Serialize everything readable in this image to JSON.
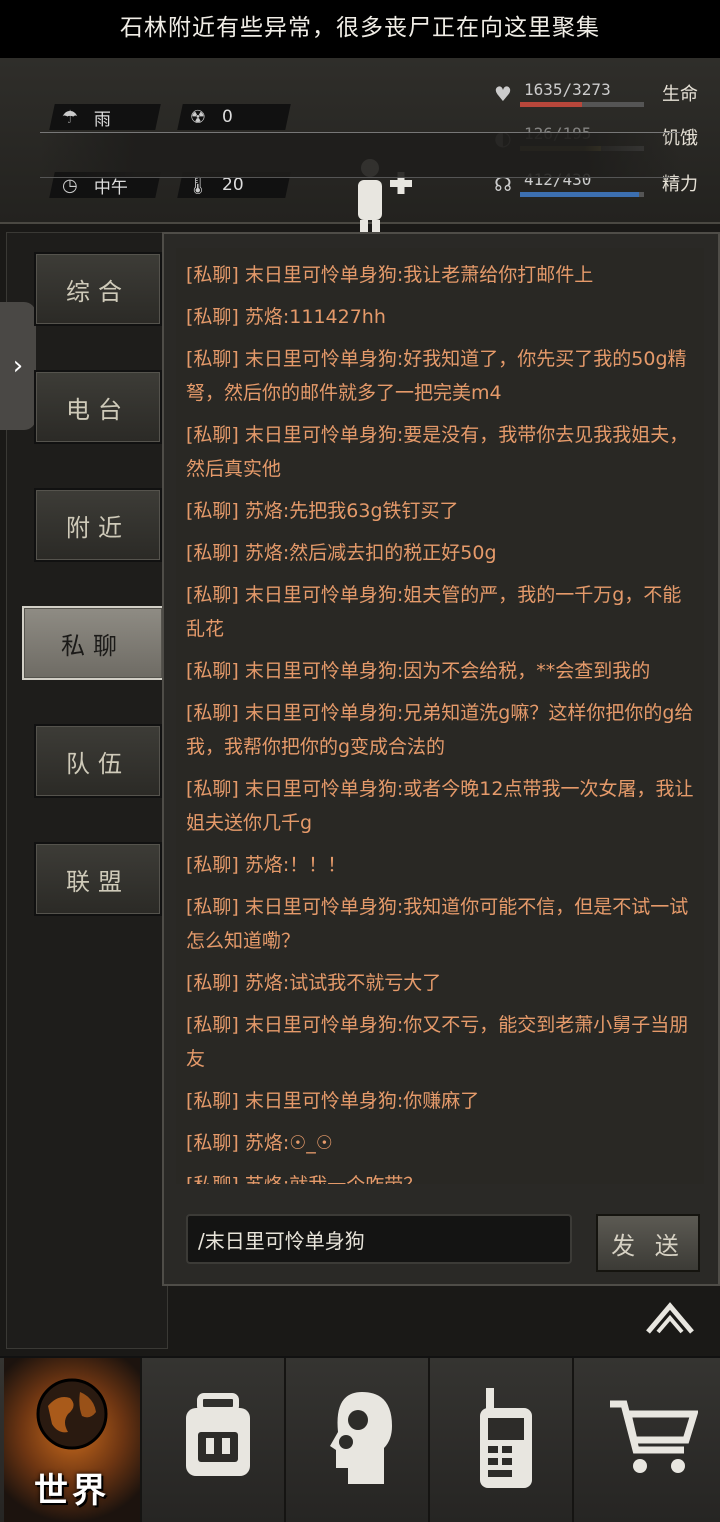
{
  "header": {
    "weather": "雨",
    "radiation": "0",
    "time_of_day": "中午",
    "temperature": "20",
    "banner": "石林附近有些异常，很多丧尸正在向这里聚集",
    "vitals": [
      {
        "label": "生命",
        "value": "1635/3273",
        "fraction": 0.5,
        "color": "#b8473b",
        "icon": "heart-icon"
      },
      {
        "label": "饥饿",
        "value": "126/195",
        "fraction": 0.65,
        "color": "#9a8a4a",
        "icon": "stomach-icon"
      },
      {
        "label": "精力",
        "value": "412/430",
        "fraction": 0.96,
        "color": "#3c6fb0",
        "icon": "brain-icon"
      }
    ]
  },
  "tabs": [
    "综合",
    "电台",
    "附近",
    "私聊",
    "队伍",
    "联盟"
  ],
  "active_tab": "私聊",
  "messages": [
    "[私聊] 末日里可怜单身狗:我让老萧给你打邮件上",
    "[私聊] 苏烙:111427hh",
    "[私聊] 末日里可怜单身狗:好我知道了，你先买了我的50g精弩，然后你的邮件就多了一把完美m4",
    "[私聊] 末日里可怜单身狗:要是没有，我带你去见我我姐夫，然后真实他",
    "[私聊] 苏烙:先把我63g铁钉买了",
    "[私聊] 苏烙:然后减去扣的税正好50g",
    "[私聊] 末日里可怜单身狗:姐夫管的严，我的一千万g，不能乱花",
    "[私聊] 末日里可怜单身狗:因为不会给税，**会查到我的",
    "[私聊] 末日里可怜单身狗:兄弟知道洗g嘛？这样你把你的g给我，我帮你把你的g变成合法的",
    "[私聊] 末日里可怜单身狗:或者今晚12点带我一次女屠，我让姐夫送你几千g",
    "[私聊] 苏烙:！！！",
    "[私聊] 末日里可怜单身狗:我知道你可能不信，但是不试一试怎么知道嘞？",
    "[私聊] 苏烙:试试我不就亏大了",
    "[私聊] 末日里可怜单身狗:你又不亏，能交到老萧小舅子当朋友",
    "[私聊] 末日里可怜单身狗:你赚麻了",
    "[私聊] 苏烙:☉_☉",
    "[私聊] 苏烙:就我一个咋带？"
  ],
  "input": {
    "value": "/末日里可怜单身狗"
  },
  "send_label": "发 送",
  "nav": {
    "world_label": "世界"
  }
}
